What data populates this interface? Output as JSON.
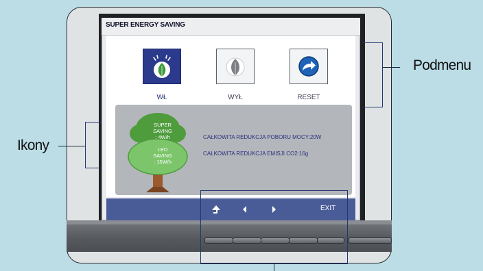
{
  "osd": {
    "title": "SUPER ENERGY SAVING",
    "options": [
      {
        "label": "WŁ",
        "icon": "leaf-icon",
        "selected": true
      },
      {
        "label": "WYŁ",
        "icon": "leaf-icon",
        "selected": false
      },
      {
        "label": "RESET",
        "icon": "reset-arrow-icon",
        "selected": false
      }
    ],
    "tree": {
      "top_line1": "SUPER",
      "top_line2": "SAVING",
      "top_line3": ": 4W/h",
      "bottom_line1": "LED",
      "bottom_line2": "SAVING",
      "bottom_line3": ": 15W/h"
    },
    "info": {
      "line1": "CAŁKOWITA REDUKCJA POBORU MOCY:20W",
      "line2": "CAŁKOWITA REDUKCJA EMISJI CO2:16g"
    },
    "nav": {
      "up_icon": "up-arrow-icon",
      "left_icon": "left-arrow-icon",
      "right_icon": "right-arrow-icon",
      "exit_label": "EXIT"
    }
  },
  "callouts": {
    "submenu": "Podmenu",
    "icons": "Ikony"
  },
  "colors": {
    "background": "#bcdde6",
    "osd_nav_bar": "#4a5c98",
    "selected_option": "#2b3a8c",
    "tree_green": "#5aa447",
    "tree_light_green": "#7cc56a",
    "callout_outline": "#23366f"
  }
}
